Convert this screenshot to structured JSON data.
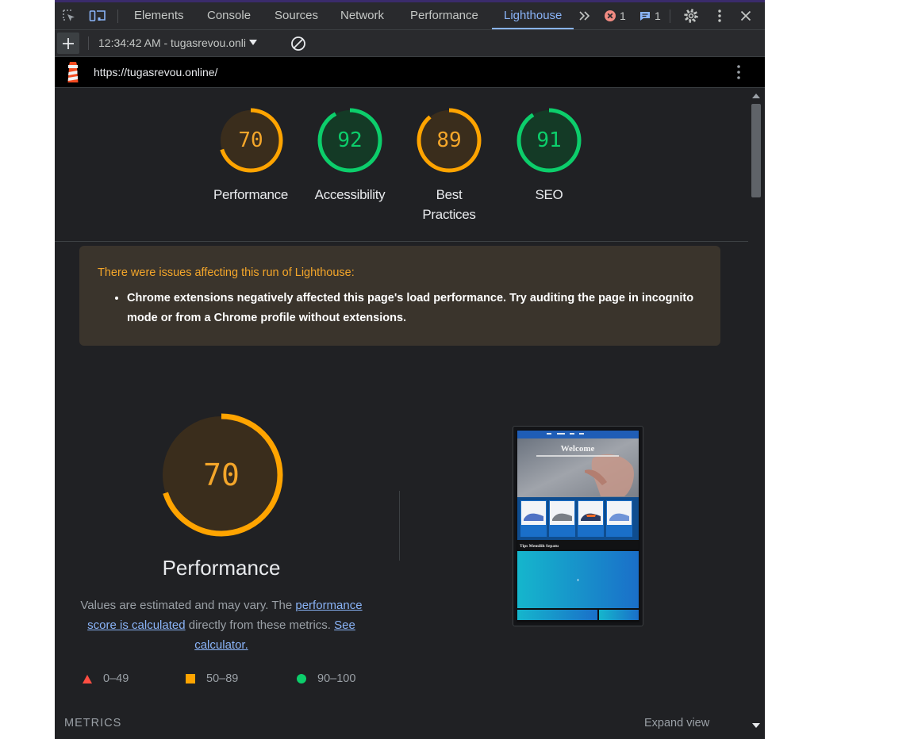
{
  "toolbar": {
    "tabs": [
      "Elements",
      "Console",
      "Sources",
      "Network",
      "Performance",
      "Lighthouse"
    ],
    "active_tab": "Lighthouse",
    "errors_count": "1",
    "messages_count": "1"
  },
  "report_bar": {
    "selected_report": "12:34:42 AM - tugasrevou.onli"
  },
  "url_bar": {
    "url": "https://tugasrevou.online/"
  },
  "scores": [
    {
      "label": "Performance",
      "score": 70,
      "rating": "average"
    },
    {
      "label": "Accessibility",
      "score": 92,
      "rating": "pass"
    },
    {
      "label": "Best Practices",
      "score": 89,
      "rating": "average"
    },
    {
      "label": "SEO",
      "score": 91,
      "rating": "pass"
    }
  ],
  "warning": {
    "title": "There were issues affecting this run of Lighthouse:",
    "items": [
      "Chrome extensions negatively affected this page's load performance. Try auditing the page in incognito mode or from a Chrome profile without extensions."
    ]
  },
  "performance": {
    "score": 70,
    "title": "Performance",
    "desc_prefix": "Values are estimated and may vary. The ",
    "desc_link1": "performance score is calculated",
    "desc_middle": " directly from these metrics. ",
    "desc_link2": "See calculator."
  },
  "legend": [
    {
      "range": "0–49",
      "shape": "triangle",
      "color": "#ff4e42"
    },
    {
      "range": "50–89",
      "shape": "square",
      "color": "#ffa400"
    },
    {
      "range": "90–100",
      "shape": "circle",
      "color": "#0cce6b"
    }
  ],
  "screenshot": {
    "heading": "Welcome",
    "section_title": "Tips Memilih Sepatu"
  },
  "metrics": {
    "header": "METRICS",
    "expand": "Expand view"
  },
  "colors": {
    "average": "#ffa400",
    "pass": "#0cce6b",
    "fail": "#ff4e42",
    "link": "#8ab4f8"
  }
}
